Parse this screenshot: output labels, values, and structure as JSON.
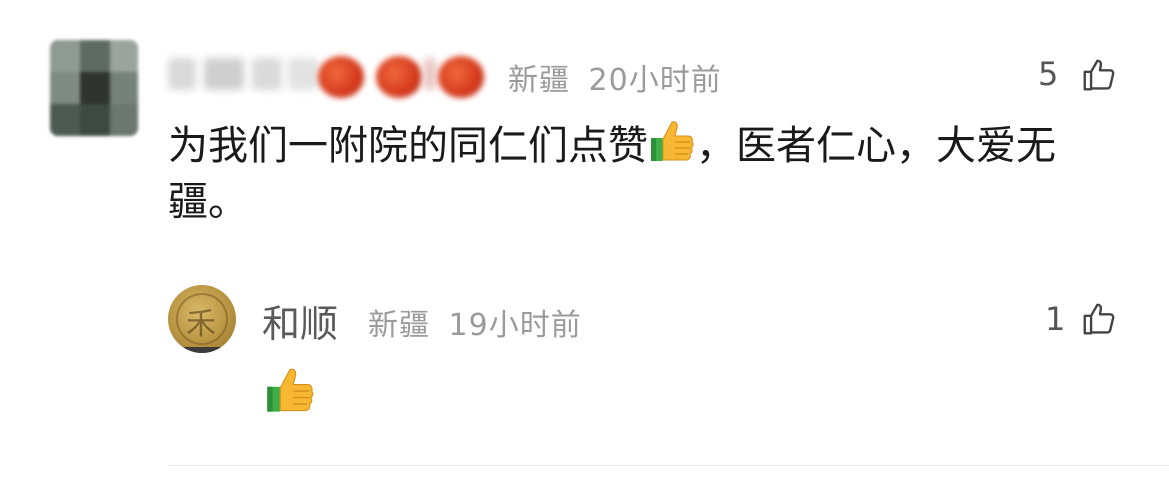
{
  "comments": [
    {
      "author": "",
      "location": "新疆",
      "time": "20小时前",
      "likes": "5",
      "text_before_emoji": "为我们一附院的同仁们点赞",
      "text_after_emoji": "，医者仁心，大爱无疆。",
      "avatar_icon": "blurred-portrait-avatar",
      "name_decoration_icons": [
        "tomato-icon",
        "tomato-icon",
        "tomato-icon"
      ],
      "replies": [
        {
          "author": "和顺",
          "location": "新疆",
          "time": "19小时前",
          "likes": "1",
          "avatar_icon": "gold-coin-avatar",
          "content_icon": "thumbs-up-emoji"
        }
      ]
    }
  ],
  "colors": {
    "meta_gray": "#9b9b9b",
    "body_text": "#1a1a1a",
    "emoji_yellow": "#f7b733",
    "emoji_green": "#3fae49"
  }
}
